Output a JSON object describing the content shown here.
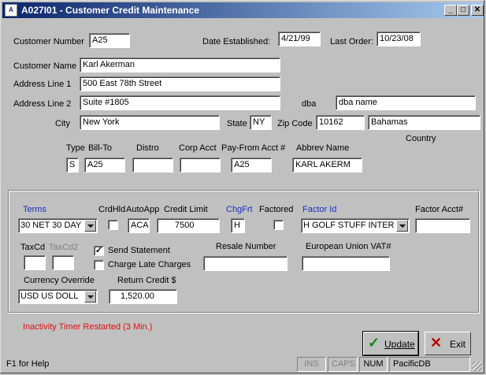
{
  "window": {
    "icon_text": "A",
    "title": "A027I01 - Customer Credit Maintenance",
    "min_glyph": "_",
    "max_glyph": "□",
    "close_glyph": "✕"
  },
  "header": {
    "customer_number_label": "Customer Number",
    "customer_number": "A25",
    "date_established_label": "Date Established:",
    "date_established": "4/21/99",
    "last_order_label": "Last Order:",
    "last_order": "10/23/08"
  },
  "address": {
    "customer_name_label": "Customer Name",
    "customer_name": "Karl Akerman",
    "line1_label": "Address Line 1",
    "line1": "500 East 78th Street",
    "line2_label": "Address Line 2",
    "line2": "Suite #1805",
    "dba_label": "dba",
    "dba": "dba name",
    "city_label": "City",
    "city": "New York",
    "state_label": "State",
    "state": "NY",
    "zip_label": "Zip Code",
    "zip": "10162",
    "country_label": "Country",
    "country": "Bahamas"
  },
  "codes": {
    "type_label": "Type",
    "type": "S",
    "billto_label": "Bill-To",
    "billto": "A25",
    "distro_label": "Distro",
    "distro": "",
    "corp_acct_label": "Corp Acct",
    "corp_acct": "",
    "payfrom_label": "Pay-From Acct #",
    "payfrom": "A25",
    "abbrev_label": "Abbrev Name",
    "abbrev": "KARL AKERM"
  },
  "credit": {
    "terms_label": "Terms",
    "terms": "30 NET 30 DAY",
    "crdhld_label": "CrdHld",
    "crdhld_checked": false,
    "autoapp_label": "AutoApp",
    "autoapp": "ACA",
    "credit_limit_label": "Credit Limit",
    "credit_limit": "7500",
    "chgfrt_label": "ChgFrt",
    "chgfrt": "H",
    "factored_label": "Factored",
    "factored_checked": false,
    "factor_id_label": "Factor Id",
    "factor_id": "H GOLF STUFF INTER",
    "factor_acct_label": "Factor Acct#",
    "factor_acct": "",
    "taxcd_label": "TaxCd",
    "taxcd": "",
    "taxcd2_label": "TaxCd2",
    "taxcd2": "",
    "send_statement_label": "Send Statement",
    "send_statement_checked": true,
    "charge_late_label": "Charge Late Charges",
    "charge_late_checked": false,
    "resale_label": "Resale Number",
    "resale": "",
    "vat_label": "European Union VAT#",
    "vat": "",
    "currency_label": "Currency Override",
    "currency": "USD  US DOLL",
    "return_credit_label": "Return Credit $",
    "return_credit": "1,520.00",
    "check_glyph": "✓"
  },
  "messages": {
    "inactivity": "Inactivity Timer Restarted (3 Min.)"
  },
  "buttons": {
    "update_icon": "✓",
    "update_label": "Update",
    "exit_icon": "✕",
    "exit_label": "Exit"
  },
  "statusbar": {
    "help": "F1 for Help",
    "ins": "INS",
    "caps": "CAPS",
    "num": "NUM",
    "db": "PacificDB"
  },
  "colors": {
    "title_start": "#0a246a",
    "title_end": "#a6caf0",
    "link_blue": "#1c2fc9",
    "alert_red": "#e01010",
    "update_check": "#0a8a0a",
    "exit_x": "#c00000"
  }
}
